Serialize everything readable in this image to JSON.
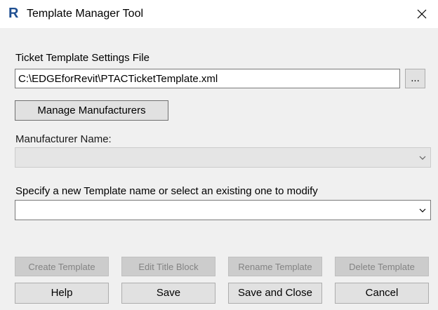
{
  "window": {
    "title": "Template Manager Tool",
    "app_icon_letter": "R",
    "close_glyph": "✕"
  },
  "settings_file": {
    "label": "Ticket Template Settings File",
    "value": "C:\\EDGEforRevit\\PTACTicketTemplate.xml",
    "browse_label": "..."
  },
  "manage_manufacturers_label": "Manage Manufacturers",
  "manufacturer": {
    "label": "Manufacturer Name:",
    "selected": ""
  },
  "template": {
    "label": "Specify a new Template name or select an existing one to modify",
    "value": ""
  },
  "actions": {
    "create_template": "Create Template",
    "edit_title_block": "Edit Title Block",
    "rename_template": "Rename Template",
    "delete_template": "Delete Template"
  },
  "footer": {
    "help": "Help",
    "save": "Save",
    "save_and_close": "Save and Close",
    "cancel": "Cancel"
  },
  "icons": {
    "app": "revit-r-icon",
    "close": "close-icon",
    "dropdown": "chevron-down-icon"
  },
  "colors": {
    "window_bg": "#f0f0f0",
    "titlebar_bg": "#ffffff",
    "app_icon": "#1f4f91",
    "button_bg": "#e1e1e1",
    "disabled_bg": "#cccccc",
    "disabled_text": "#838383"
  }
}
